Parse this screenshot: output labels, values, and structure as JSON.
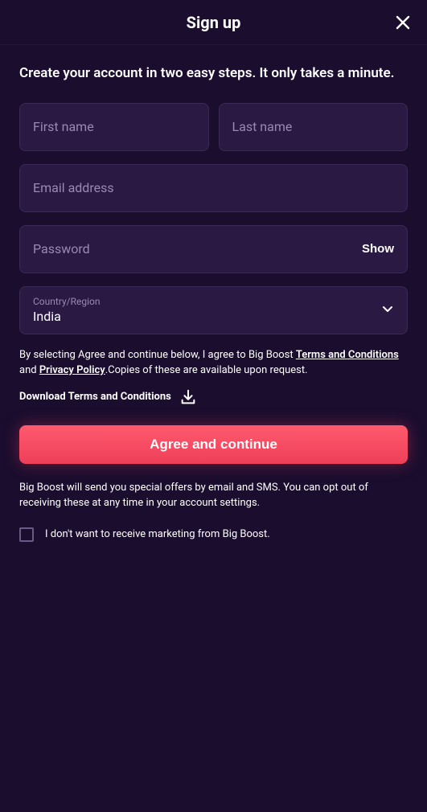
{
  "header": {
    "title": "Sign up"
  },
  "subtitle": "Create your account in two easy steps. It only takes a minute.",
  "fields": {
    "first_name_placeholder": "First name",
    "last_name_placeholder": "Last name",
    "email_placeholder": "Email address",
    "password_placeholder": "Password",
    "show_label": "Show",
    "country_label": "Country/Region",
    "country_value": "India"
  },
  "terms": {
    "prefix": "By selecting Agree and continue below, I agree to Big Boost ",
    "terms_link": "Terms and Conditions",
    "mid": " and ",
    "privacy_link": "Privacy Policy",
    "suffix": ".Copies of these are available upon request."
  },
  "download_label": "Download Terms and Conditions",
  "cta_label": "Agree and continue",
  "marketing_text": "Big Boost will send you special offers by email and SMS. You can opt out of receiving these at any time in your account settings.",
  "checkbox_label": "I don't want to receive marketing from Big Boost."
}
